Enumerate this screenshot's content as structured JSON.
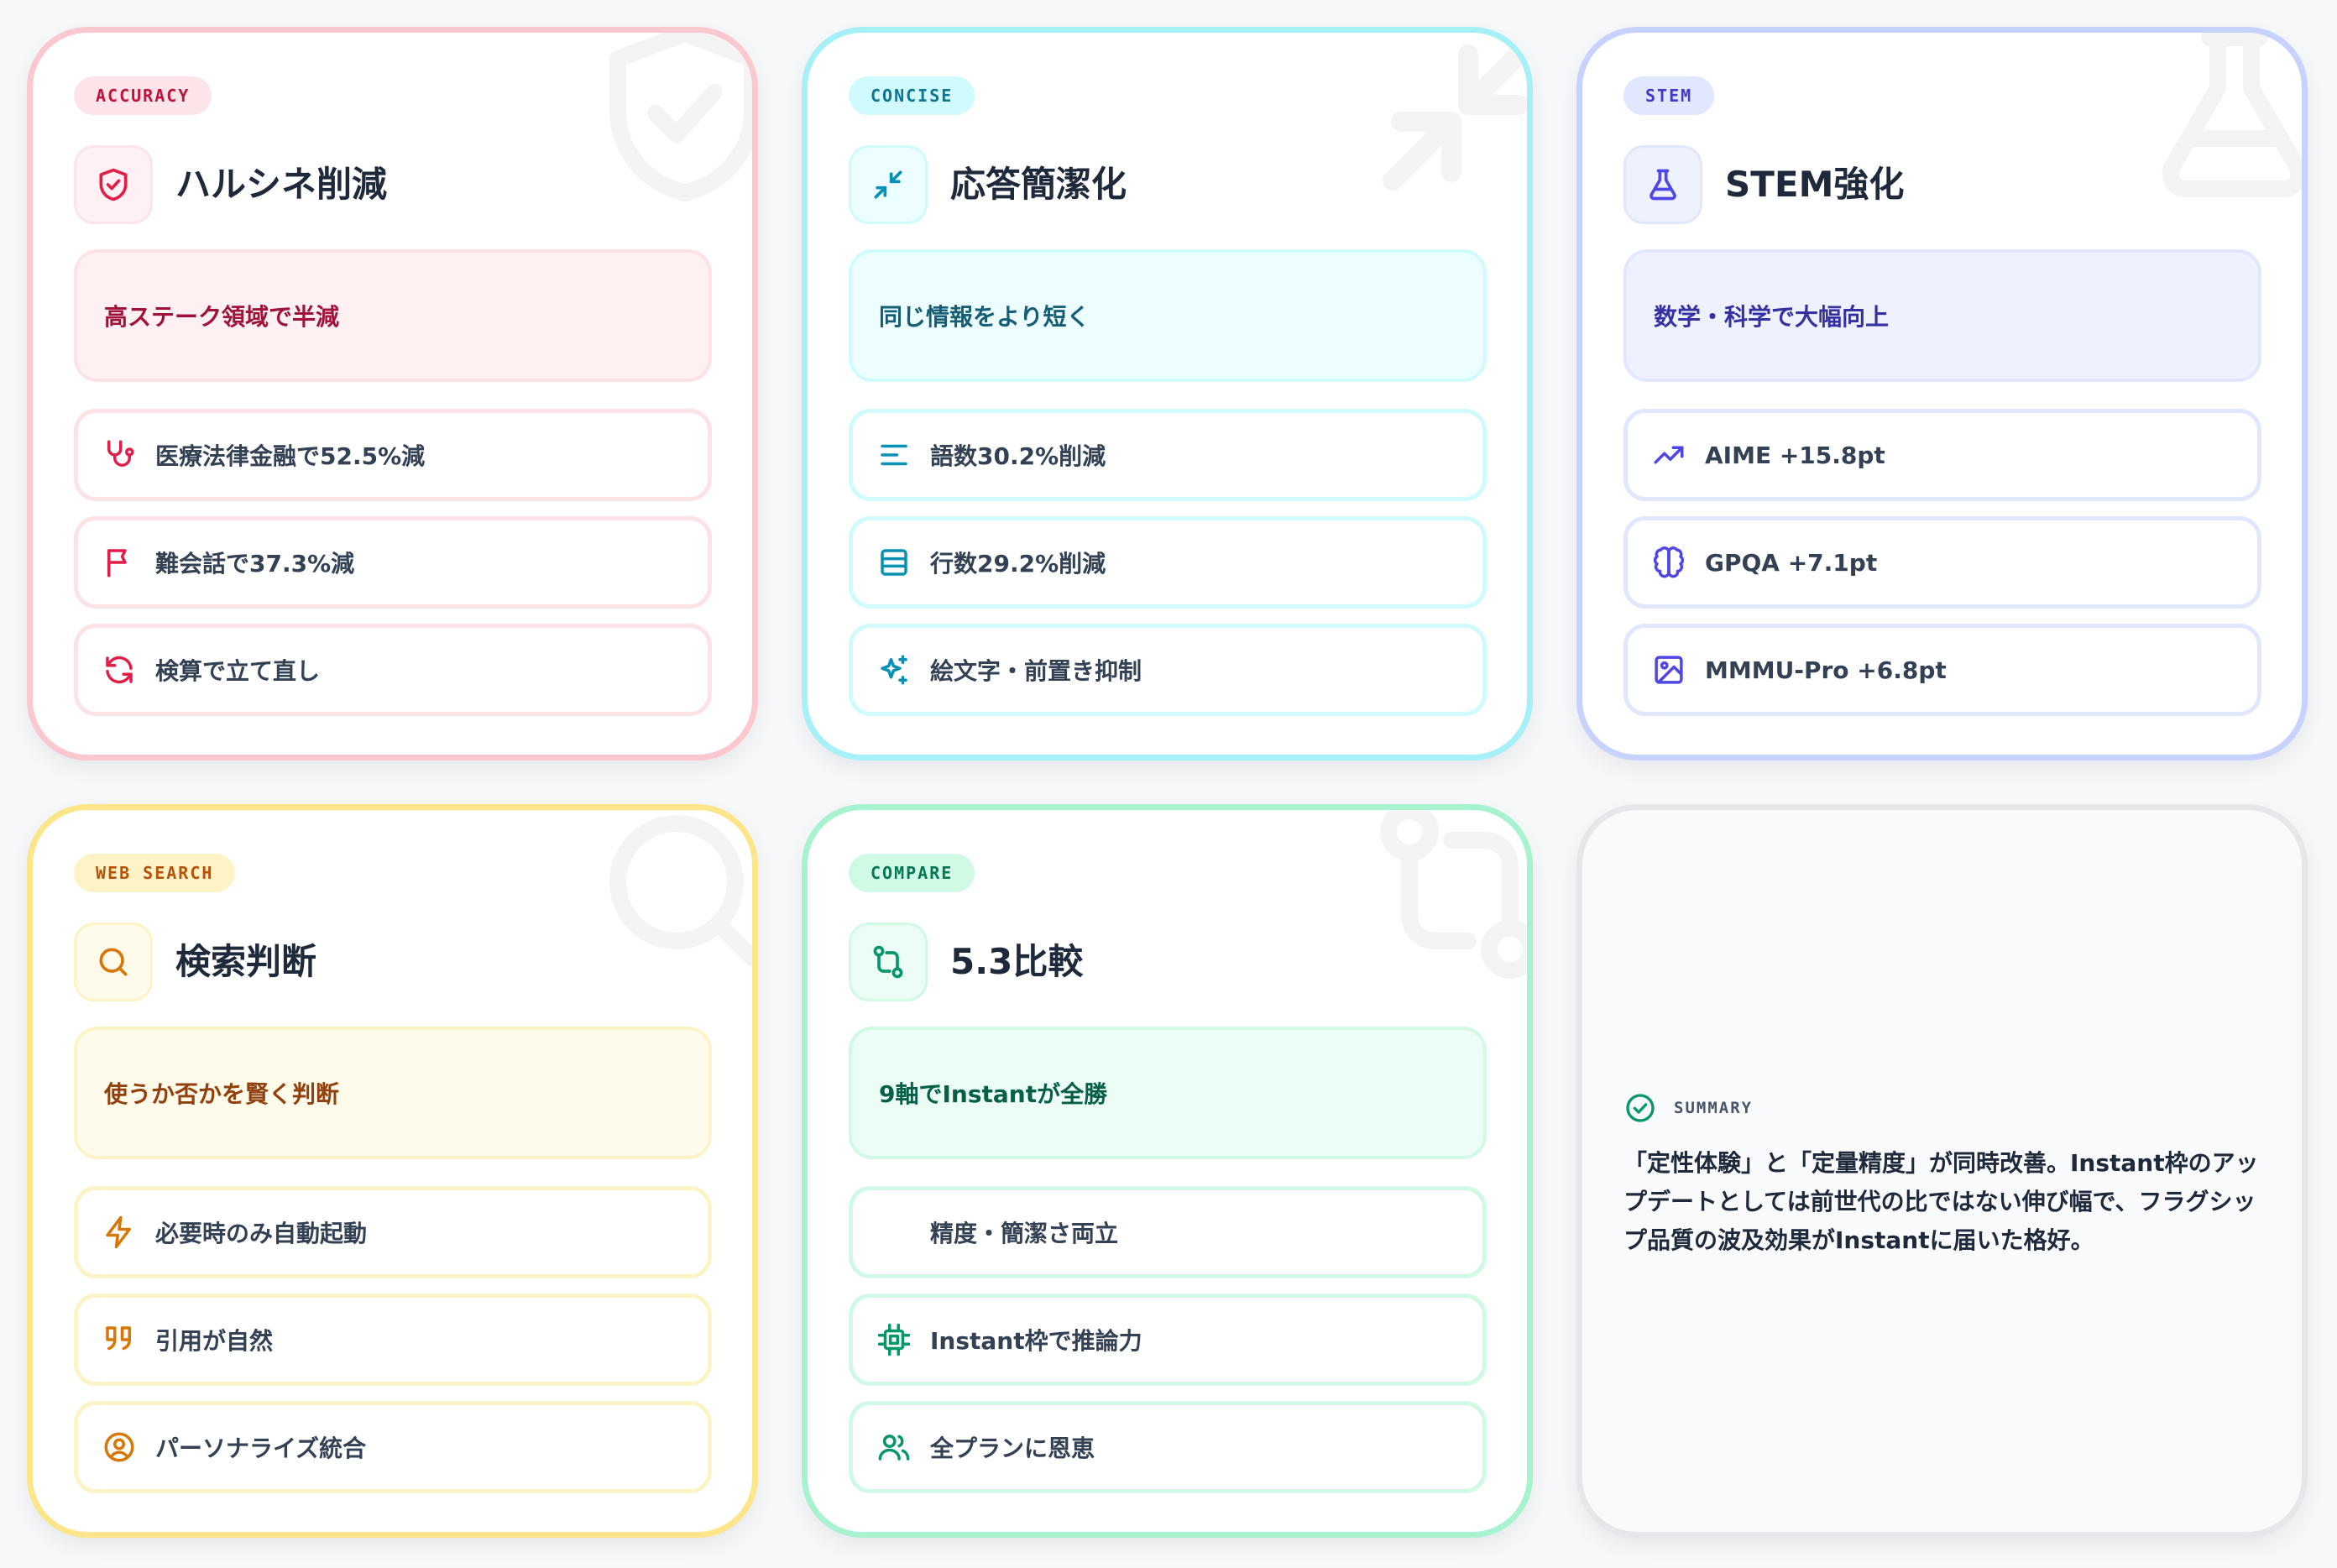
{
  "cards": [
    {
      "tag": "ACCURACY",
      "title": "ハルシネ削減",
      "highlight": "高ステーク領域で半減",
      "title_icon": "shield-check-icon",
      "watermark_icon": "shield-check-icon",
      "items": [
        {
          "icon": "stethoscope-icon",
          "label": "医療法律金融で52.5%減"
        },
        {
          "icon": "flag-icon",
          "label": "難会話で37.3%減"
        },
        {
          "icon": "refresh-icon",
          "label": "検算で立て直し"
        }
      ]
    },
    {
      "tag": "CONCISE",
      "title": "応答簡潔化",
      "highlight": "同じ情報をより短く",
      "title_icon": "minimize-icon",
      "watermark_icon": "minimize-icon",
      "items": [
        {
          "icon": "align-left-icon",
          "label": "語数30.2%削減"
        },
        {
          "icon": "rows-icon",
          "label": "行数29.2%削減"
        },
        {
          "icon": "sparkles-icon",
          "label": "絵文字・前置き抑制"
        }
      ]
    },
    {
      "tag": "STEM",
      "title": "STEM強化",
      "highlight": "数学・科学で大幅向上",
      "title_icon": "flask-icon",
      "watermark_icon": "flask-icon",
      "items": [
        {
          "icon": "trending-up-icon",
          "label": "AIME +15.8pt"
        },
        {
          "icon": "brain-icon",
          "label": "GPQA +7.1pt"
        },
        {
          "icon": "image-icon",
          "label": "MMMU-Pro +6.8pt"
        }
      ]
    },
    {
      "tag": "WEB SEARCH",
      "title": "検索判断",
      "highlight": "使うか否かを賢く判断",
      "title_icon": "search-icon",
      "watermark_icon": "search-icon",
      "items": [
        {
          "icon": "zap-icon",
          "label": "必要時のみ自動起動"
        },
        {
          "icon": "quote-icon",
          "label": "引用が自然"
        },
        {
          "icon": "user-circle-icon",
          "label": "パーソナライズ統合"
        }
      ]
    },
    {
      "tag": "COMPARE",
      "title": "5.3比較",
      "highlight": "9軸でInstantが全勝",
      "title_icon": "git-compare-icon",
      "watermark_icon": "git-compare-icon",
      "items": [
        {
          "icon": "",
          "label": "精度・簡潔さ両立"
        },
        {
          "icon": "cpu-icon",
          "label": "Instant枠で推論力"
        },
        {
          "icon": "users-icon",
          "label": "全プランに恩恵"
        }
      ]
    }
  ],
  "summary": {
    "icon": "check-circle-icon",
    "label": "SUMMARY",
    "text": "「定性体験」と「定量精度」が同時改善。Instant枠のアップデートとしては前世代の比ではない伸び幅で、フラグシップ品質の波及効果がInstantに届いた格好。"
  }
}
